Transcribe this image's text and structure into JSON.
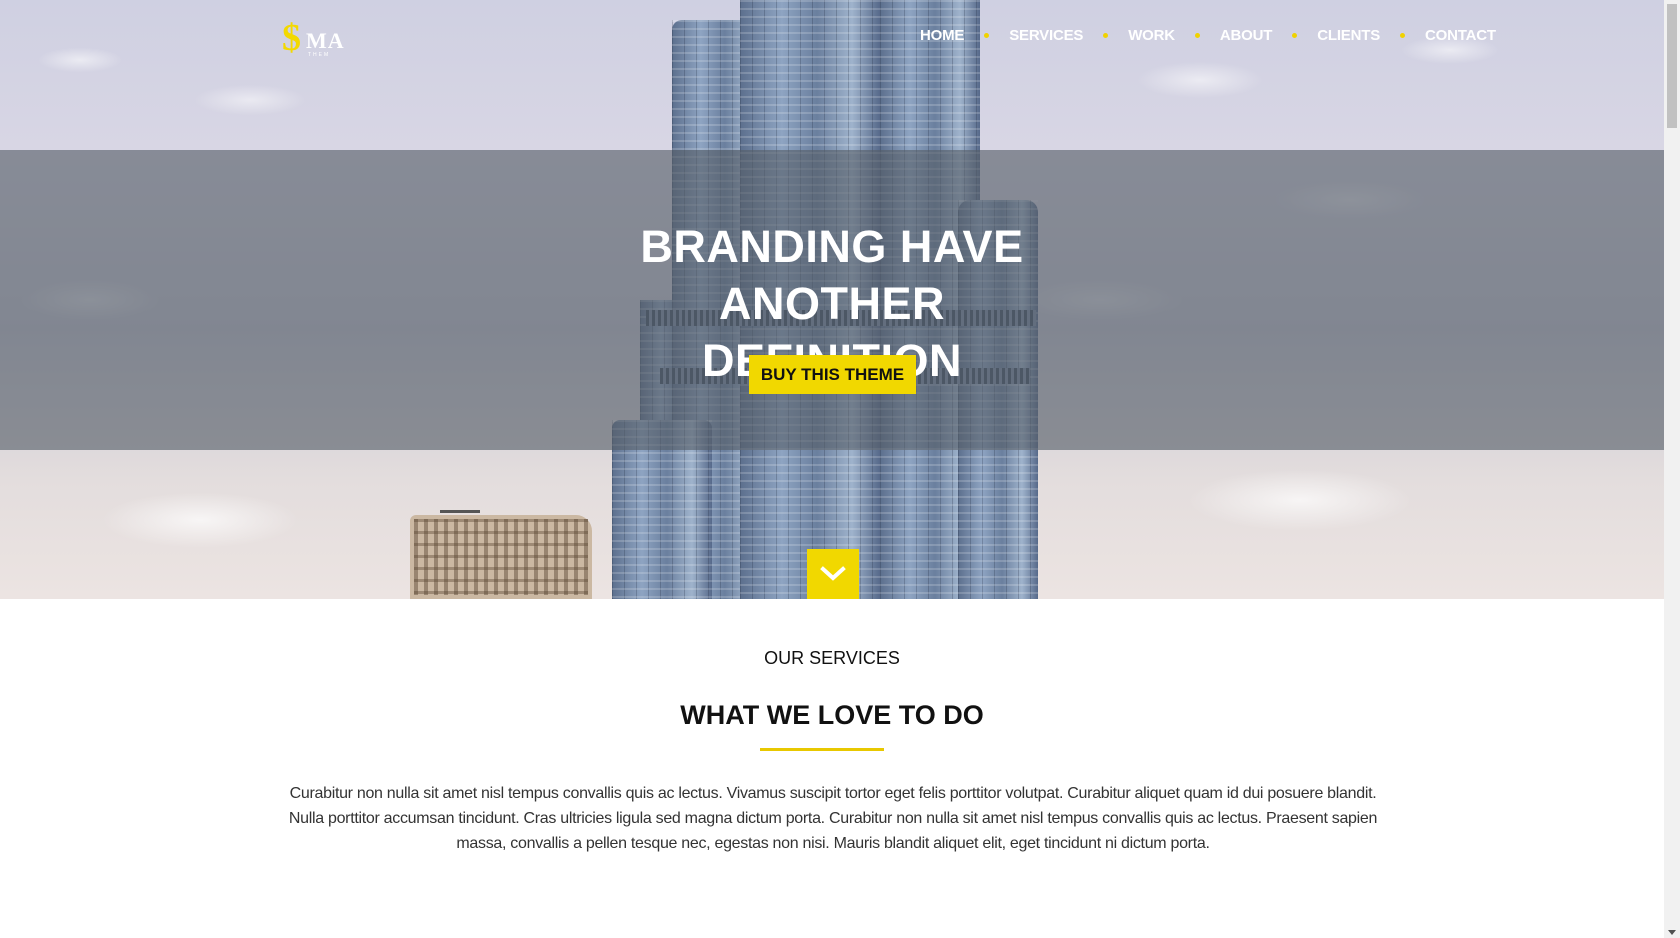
{
  "logo": {
    "symbol": "$",
    "text": "MA",
    "subtext": "THEM"
  },
  "nav": {
    "items": [
      {
        "label": "HOME"
      },
      {
        "label": "SERVICES"
      },
      {
        "label": "WORK"
      },
      {
        "label": "ABOUT"
      },
      {
        "label": "CLIENTS"
      },
      {
        "label": "CONTACT"
      }
    ]
  },
  "hero": {
    "title_line1": "BRANDING HAVE ANOTHER",
    "title_line2": "DEFINITION",
    "cta_label": "BUY THIS THEME",
    "scroll_icon": "chevron-down-icon"
  },
  "services": {
    "kicker": "OUR SERVICES",
    "title": "WHAT WE LOVE TO DO",
    "body": "Curabitur non nulla sit amet nisl tempus convallis quis ac lectus. Vivamus suscipit tortor eget felis porttitor volutpat. Curabitur aliquet quam id dui posuere blandit. Nulla porttitor accumsan tincidunt. Cras ultricies ligula sed magna dictum porta. Curabitur non nulla sit amet nisl tempus convallis quis ac lectus. Praesent sapien massa, convallis a pellen tesque nec, egestas non nisi. Mauris blandit aliquet elit, eget tincidunt ni dictum porta."
  },
  "colors": {
    "accent": "#f1d800",
    "text": "#111111",
    "overlay": "rgba(85,94,104,0.62)"
  }
}
